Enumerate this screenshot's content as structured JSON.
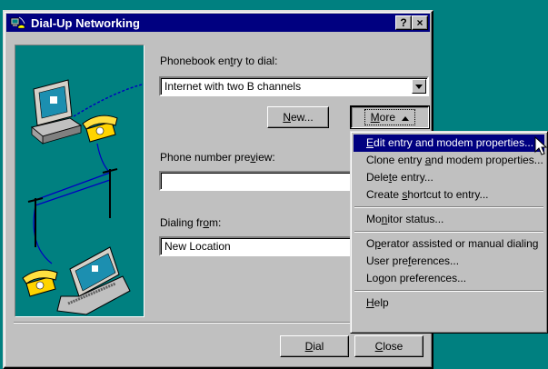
{
  "window": {
    "title": "Dial-Up Networking",
    "help_button": "?",
    "close_button": "×"
  },
  "form": {
    "phonebook_label_pre": "Phonebook en",
    "phonebook_label_u": "t",
    "phonebook_label_post": "ry to dial:",
    "phonebook_value": "Internet with two B channels",
    "new_button_u": "N",
    "new_button_post": "ew...",
    "more_button_u": "M",
    "more_button_post": "ore",
    "phone_preview_label_pre": "Phone number pre",
    "phone_preview_label_u": "v",
    "phone_preview_label_post": "iew:",
    "phone_preview_value": "",
    "dialing_from_label_pre": "Dialing fr",
    "dialing_from_label_u": "o",
    "dialing_from_label_post": "m:",
    "dialing_from_value": "New Location",
    "dial_button_u": "D",
    "dial_button_post": "ial",
    "close_button_u": "C",
    "close_button_post": "lose"
  },
  "menu": {
    "items": [
      {
        "pre": "",
        "u": "E",
        "post": "dit entry and modem properties...",
        "selected": true
      },
      {
        "pre": "Clone entry ",
        "u": "a",
        "post": "nd modem properties...",
        "selected": false
      },
      {
        "pre": "Dele",
        "u": "t",
        "post": "e entry...",
        "selected": false
      },
      {
        "pre": "Create ",
        "u": "s",
        "post": "hortcut to entry...",
        "selected": false
      },
      {
        "pre": "Mo",
        "u": "n",
        "post": "itor status...",
        "selected": false
      },
      {
        "pre": "O",
        "u": "p",
        "post": "erator assisted or manual dialing",
        "selected": false
      },
      {
        "pre": "User pre",
        "u": "f",
        "post": "erences...",
        "selected": false
      },
      {
        "pre": "Logon preferences...",
        "u": "",
        "post": "",
        "selected": false
      },
      {
        "pre": "",
        "u": "H",
        "post": "elp",
        "selected": false
      }
    ]
  },
  "colors": {
    "desktop": "#008080",
    "titlebar": "#000080",
    "face": "#c0c0c0",
    "highlight": "#000080"
  }
}
